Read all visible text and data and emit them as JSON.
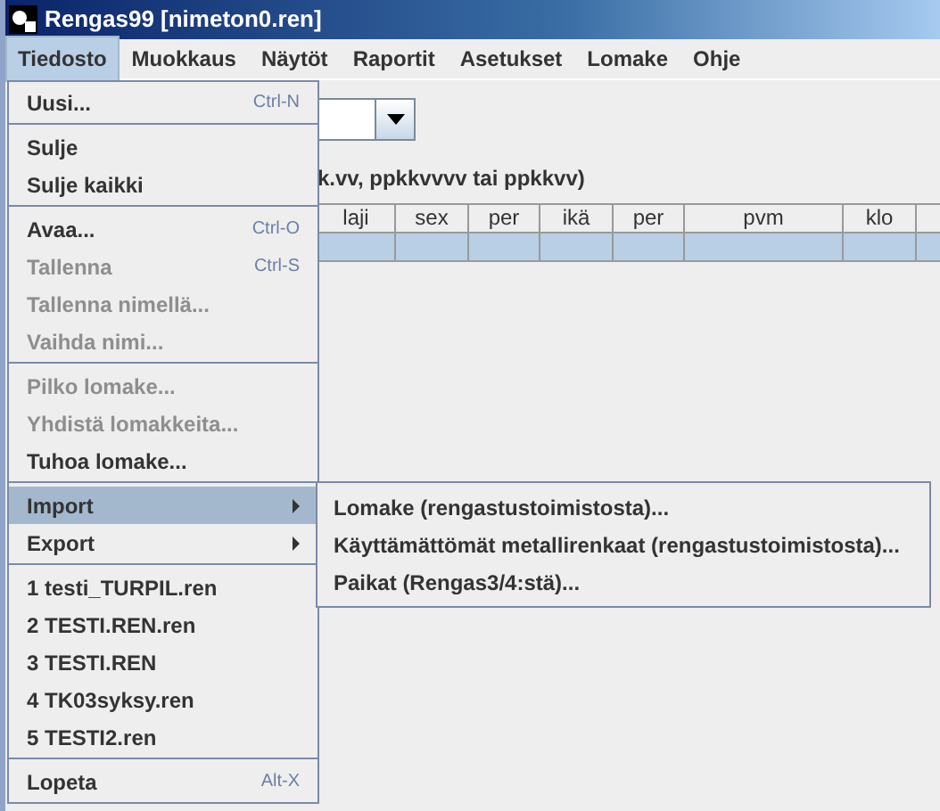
{
  "window": {
    "title": "Rengas99  [nimeton0.ren]"
  },
  "menubar": [
    {
      "label": "Tiedosto",
      "selected": true
    },
    {
      "label": "Muokkaus",
      "selected": false
    },
    {
      "label": "Näytöt",
      "selected": false
    },
    {
      "label": "Raportit",
      "selected": false
    },
    {
      "label": "Asetukset",
      "selected": false
    },
    {
      "label": "Lomake",
      "selected": false
    },
    {
      "label": "Ohje",
      "selected": false
    }
  ],
  "content": {
    "hint": "k.vv, ppkkvvvv tai ppkkvv)",
    "table": {
      "columns": [
        "laji",
        "sex",
        "per",
        "ikä",
        "per",
        "pvm",
        "klo"
      ],
      "rows": [
        {
          "selected": true
        }
      ]
    }
  },
  "file_menu": [
    {
      "kind": "item",
      "label": "Uusi...",
      "shortcut": "Ctrl-N",
      "disabled": false,
      "selected": false
    },
    {
      "kind": "separator"
    },
    {
      "kind": "item",
      "label": "Sulje",
      "disabled": false,
      "selected": false
    },
    {
      "kind": "item",
      "label": "Sulje kaikki",
      "disabled": false,
      "selected": false
    },
    {
      "kind": "separator"
    },
    {
      "kind": "item",
      "label": "Avaa...",
      "shortcut": "Ctrl-O",
      "disabled": false,
      "selected": false
    },
    {
      "kind": "item",
      "label": "Tallenna",
      "shortcut": "Ctrl-S",
      "disabled": true,
      "selected": false
    },
    {
      "kind": "item",
      "label": "Tallenna nimellä...",
      "disabled": true,
      "selected": false
    },
    {
      "kind": "item",
      "label": "Vaihda nimi...",
      "disabled": true,
      "selected": false
    },
    {
      "kind": "separator"
    },
    {
      "kind": "item",
      "label": "Pilko lomake...",
      "disabled": true,
      "selected": false
    },
    {
      "kind": "item",
      "label": "Yhdistä lomakkeita...",
      "disabled": true,
      "selected": false
    },
    {
      "kind": "item",
      "label": "Tuhoa lomake...",
      "disabled": false,
      "selected": false
    },
    {
      "kind": "separator"
    },
    {
      "kind": "submenu",
      "label": "Import",
      "disabled": false,
      "selected": true
    },
    {
      "kind": "submenu",
      "label": "Export",
      "disabled": false,
      "selected": false
    },
    {
      "kind": "separator"
    },
    {
      "kind": "item",
      "label": "1 testi_TURPIL.ren",
      "disabled": false,
      "selected": false
    },
    {
      "kind": "item",
      "label": "2 TESTI.REN.ren",
      "disabled": false,
      "selected": false
    },
    {
      "kind": "item",
      "label": "3 TESTI.REN",
      "disabled": false,
      "selected": false
    },
    {
      "kind": "item",
      "label": "4 TK03syksy.ren",
      "disabled": false,
      "selected": false
    },
    {
      "kind": "item",
      "label": "5 TESTI2.ren",
      "disabled": false,
      "selected": false
    },
    {
      "kind": "separator"
    },
    {
      "kind": "item",
      "label": "Lopeta",
      "shortcut": "Alt-X",
      "disabled": false,
      "selected": false
    }
  ],
  "import_submenu": [
    {
      "label": "Lomake (rengastustoimistosta)..."
    },
    {
      "label": "Käyttämättömät metallirenkaat (rengastustoimistosta)..."
    },
    {
      "label": "Paikat (Rengas3/4:stä)..."
    }
  ]
}
